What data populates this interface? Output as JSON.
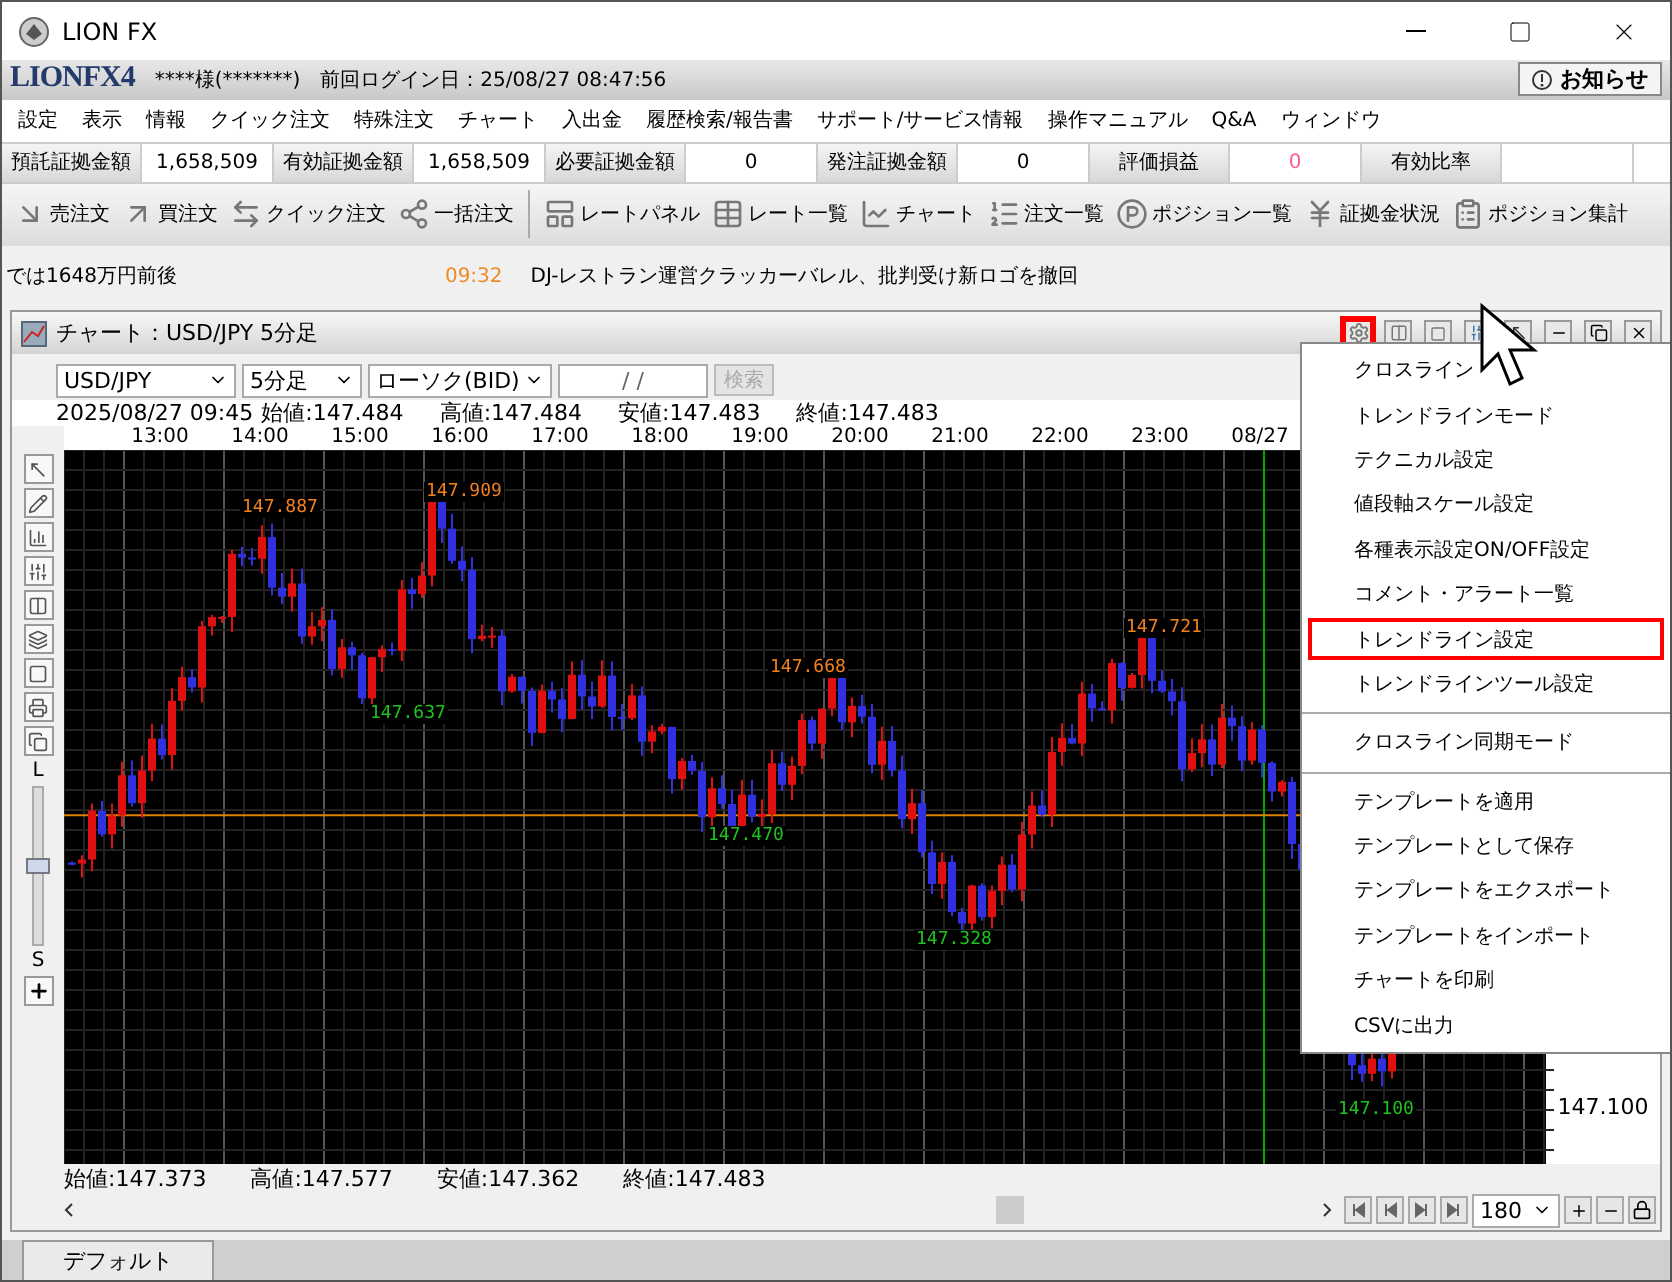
{
  "window": {
    "title": "LION FX"
  },
  "header": {
    "logo": "LIONFX4",
    "user": "****様(*******)",
    "last_login": "前回ログイン日：25/08/27 08:47:56",
    "notice_button": "お知らせ"
  },
  "menu_bar": [
    "設定",
    "表示",
    "情報",
    "クイック注文",
    "特殊注文",
    "チャート",
    "入出金",
    "履歴検索/報告書",
    "サポート/サービス情報",
    "操作マニュアル",
    "Q&A",
    "ウィンドウ"
  ],
  "account": [
    {
      "label": "預託証拠金額",
      "value": "1,658,509"
    },
    {
      "label": "有効証拠金額",
      "value": "1,658,509"
    },
    {
      "label": "必要証拠金額",
      "value": "0"
    },
    {
      "label": "発注証拠金額",
      "value": "0"
    },
    {
      "label": "評価損益",
      "value": "0",
      "color": "#ff5c8a"
    },
    {
      "label": "有効比率"
    }
  ],
  "toolbar": [
    {
      "label": "売注文",
      "kind": "sell"
    },
    {
      "label": "買注文",
      "kind": "buy"
    },
    {
      "label": "クイック注文",
      "kind": "quick"
    },
    {
      "label": "一括注文",
      "kind": "bulk"
    },
    {
      "label": "レートパネル",
      "kind": "panel"
    },
    {
      "label": "レート一覧",
      "kind": "list"
    },
    {
      "label": "チャート",
      "kind": "chart"
    },
    {
      "label": "注文一覧",
      "kind": "orders"
    },
    {
      "label": "ポジション一覧",
      "kind": "positions"
    },
    {
      "label": "証拠金状況",
      "kind": "yen"
    },
    {
      "label": "ポジション集計",
      "kind": "summary"
    }
  ],
  "ticker": {
    "lead": "では1648万円前後",
    "time": "09:32",
    "headline": "DJ-レストラン運営クラッカーバレル、批判受け新ロゴを撤回"
  },
  "chart_window": {
    "title": "チャート：USD/JPY 5分足",
    "settings_highlighted": true,
    "controls": {
      "pair": "USD/JPY",
      "period": "5分足",
      "type": "ローソク(BID)",
      "date": "/ /",
      "search": "検索",
      "search_disabled": true
    },
    "ohlc_top": {
      "time": "2025/08/27 09:45",
      "values": [
        "始値:147.484",
        "高値:147.484",
        "安値:147.483",
        "終値:147.483"
      ]
    },
    "time_labels": [
      "13:00",
      "14:00",
      "15:00",
      "16:00",
      "17:00",
      "18:00",
      "19:00",
      "20:00",
      "21:00",
      "22:00",
      "23:00",
      "08/27"
    ],
    "price_marks": [
      {
        "text": "147.887",
        "kind": "high"
      },
      {
        "text": "147.909",
        "kind": "high"
      },
      {
        "text": "147.637",
        "kind": "low"
      },
      {
        "text": "147.668",
        "kind": "high"
      },
      {
        "text": "147.470",
        "kind": "low"
      },
      {
        "text": "147.721",
        "kind": "high"
      },
      {
        "text": "147.328",
        "kind": "low"
      },
      {
        "text": "147.100",
        "kind": "low"
      }
    ],
    "price_axis": [
      "147.100"
    ],
    "zoom_slider": {
      "top_label": "L",
      "bottom_label": "S",
      "level": 0.5
    },
    "ohlc_bottom": [
      "始値:147.373",
      "高値:147.577",
      "安値:147.362",
      "終値:147.483"
    ],
    "bar_count": "180"
  },
  "context_menu": {
    "groups": [
      [
        {
          "label": "クロスライン",
          "highlighted": false
        },
        {
          "label": "トレンドラインモード",
          "highlighted": false
        },
        {
          "label": "テクニカル設定",
          "highlighted": false
        },
        {
          "label": "値段軸スケール設定",
          "highlighted": false
        },
        {
          "label": "各種表示設定ON/OFF設定",
          "highlighted": false
        },
        {
          "label": "コメント・アラート一覧",
          "highlighted": false
        },
        {
          "label": "トレンドライン設定",
          "highlighted": true
        },
        {
          "label": "トレンドラインツール設定",
          "highlighted": false
        }
      ],
      [
        {
          "label": "クロスライン同期モード",
          "highlighted": false
        }
      ],
      [
        {
          "label": "テンプレートを適用",
          "highlighted": false
        },
        {
          "label": "テンプレートとして保存",
          "highlighted": false
        },
        {
          "label": "テンプレートをエクスポート",
          "highlighted": false
        },
        {
          "label": "テンプレートをインポート",
          "highlighted": false
        },
        {
          "label": "チャートを印刷",
          "highlighted": false
        },
        {
          "label": "CSVに出力",
          "highlighted": false
        }
      ]
    ]
  },
  "tabs": [
    {
      "label": "デフォルト",
      "selected": true
    }
  ]
}
